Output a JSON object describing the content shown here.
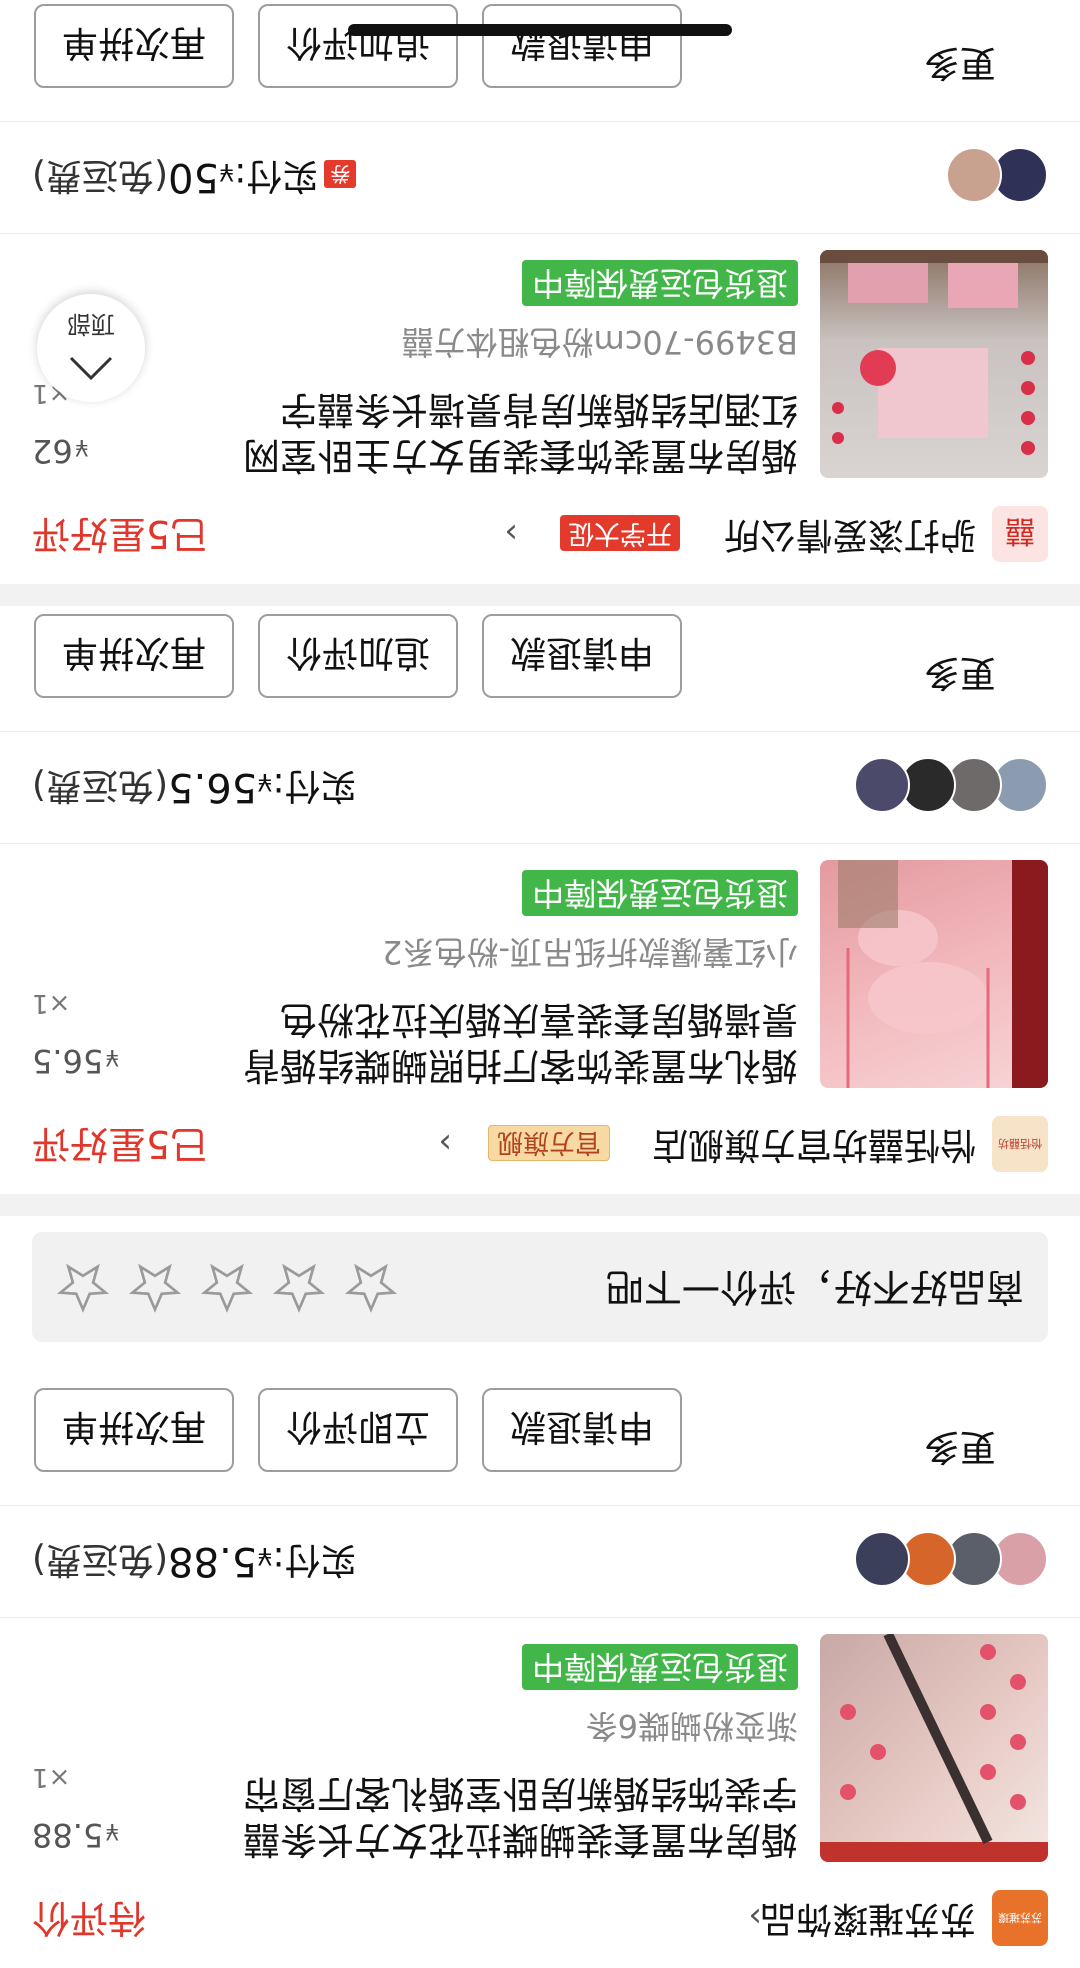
{
  "back_to_top": {
    "label": "顶部"
  },
  "orders": [
    {
      "shop": {
        "name": "苏苏璀璨饰品",
        "logo_text": "苏苏璀璨"
      },
      "status": "待评价",
      "product": {
        "title": "婚房布置套装蝴蝶拉花女方长条囍字装饰结婚新房卧室婚礼客厅窗帘",
        "spec": "渐变粉蝴蝶6条",
        "guarantee": "退货包运费保障中",
        "currency": "¥",
        "price": "5.88",
        "qty": "×1"
      },
      "pay": {
        "label": "实付:",
        "currency": "¥",
        "amount": "5.88",
        "note": "(免运费)"
      },
      "buttons": {
        "more": "更多",
        "refund": "申请退款",
        "review": "立即评价",
        "rebuy": "再次拼单"
      },
      "rating": {
        "prompt": "商品好不好，评价一下吧",
        "stars": 5
      }
    },
    {
      "shop": {
        "name": "怡恬囍坊官方旗舰店",
        "badge": "官方旗舰",
        "logo_text": "怡恬囍坊"
      },
      "status": "已5星好评",
      "product": {
        "title": "婚礼布置装饰客厅拍照蝴蝶结婚背景墙婚房套装喜庆婚庆拉花粉色",
        "spec": "小红薯爆款折纸吊顶-粉色系2",
        "guarantee": "退货包运费保障中",
        "currency": "¥",
        "price": "56.5",
        "qty": "×1"
      },
      "pay": {
        "label": "实付:",
        "currency": "¥",
        "amount": "56.5",
        "note": "(免运费)"
      },
      "buttons": {
        "more": "更多",
        "refund": "申请退款",
        "review": "追加评价",
        "rebuy": "再次拼单"
      }
    },
    {
      "shop": {
        "name": "驴打滚爱情公所",
        "badge": "开学大促",
        "logo_text": "囍"
      },
      "status": "已5星好评",
      "product": {
        "title": "婚房布置装饰套装男女方主卧室网红酒店结婚新房背景墙长条囍字",
        "spec": "B3499-70cm粉色粗体方囍",
        "guarantee": "退货包运费保障中",
        "currency": "¥",
        "price": "62",
        "qty": "×1"
      },
      "pay": {
        "label": "实付:",
        "currency": "¥",
        "amount": "50",
        "note": "(免运费)",
        "coupon": "券"
      },
      "buttons": {
        "more": "更多",
        "refund": "申请退款",
        "review": "追加评价",
        "rebuy": "再次拼单"
      }
    }
  ],
  "colors": {
    "accent_red": "#e0362b",
    "guarantee_green": "#42b649",
    "badge_gold": "#f7d9a4"
  }
}
